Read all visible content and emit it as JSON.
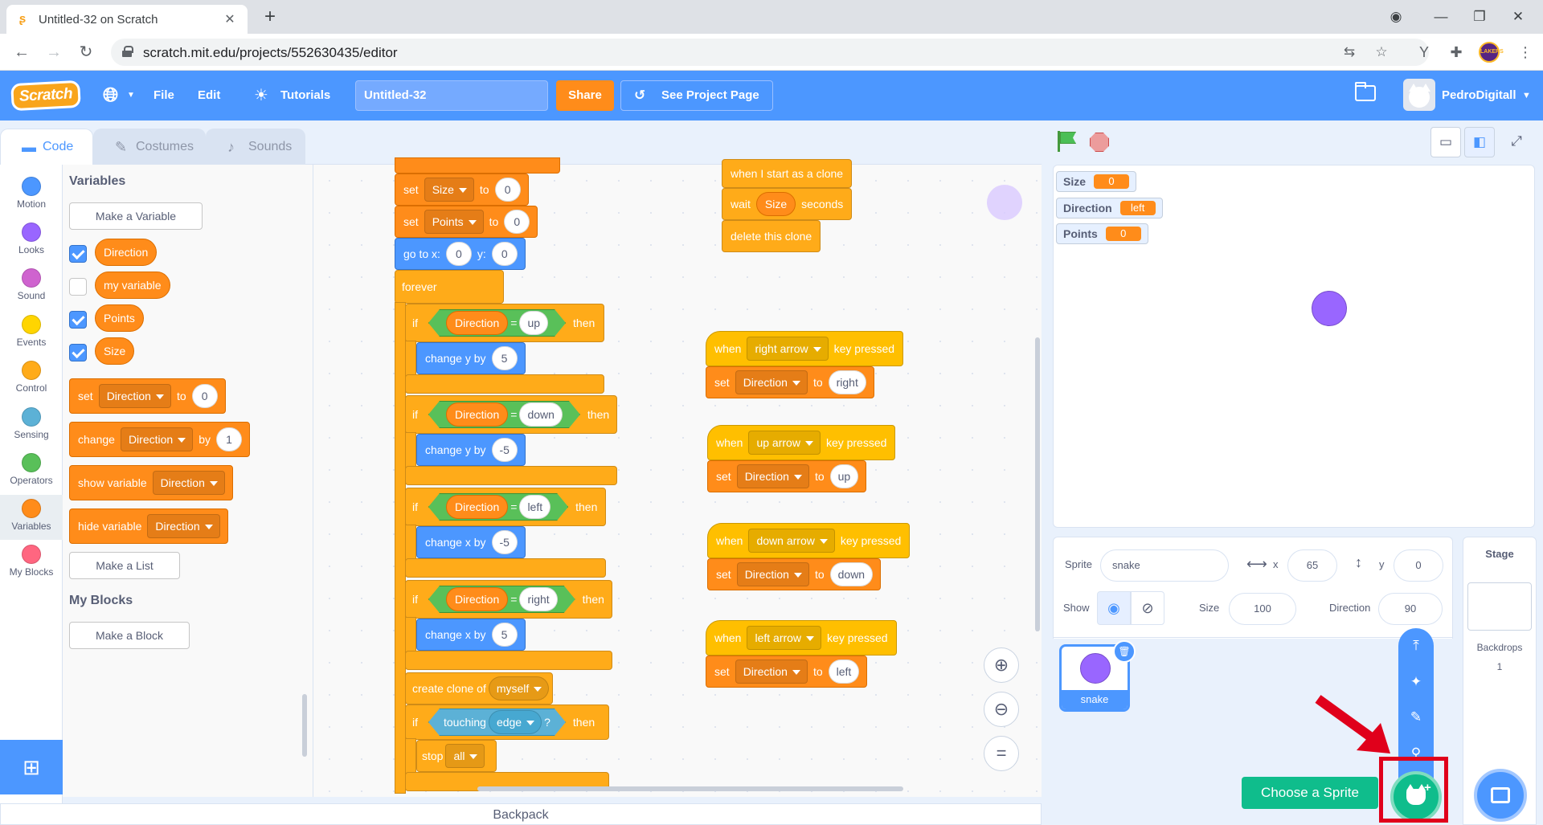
{
  "browser": {
    "tab_title": "Untitled-32 on Scratch",
    "url": "scratch.mit.edu/projects/552630435/editor",
    "profile_badge": "LAKERS"
  },
  "menubar": {
    "logo": "Scratch",
    "file": "File",
    "edit": "Edit",
    "tutorials": "Tutorials",
    "project_title": "Untitled-32",
    "share": "Share",
    "see_project_page": "See Project Page",
    "username": "PedroDigitall"
  },
  "tabs": {
    "code": "Code",
    "costumes": "Costumes",
    "sounds": "Sounds"
  },
  "categories": [
    {
      "label": "Motion",
      "color": "#4c97ff"
    },
    {
      "label": "Looks",
      "color": "#9966ff"
    },
    {
      "label": "Sound",
      "color": "#cf63cf"
    },
    {
      "label": "Events",
      "color": "#ffd500"
    },
    {
      "label": "Control",
      "color": "#ffab19"
    },
    {
      "label": "Sensing",
      "color": "#5cb1d6"
    },
    {
      "label": "Operators",
      "color": "#59c059"
    },
    {
      "label": "Variables",
      "color": "#ff8c1a"
    },
    {
      "label": "My Blocks",
      "color": "#ff6680"
    }
  ],
  "palette": {
    "variables_heading": "Variables",
    "make_variable": "Make a Variable",
    "variables": [
      {
        "name": "Direction",
        "checked": true
      },
      {
        "name": "my variable",
        "checked": false
      },
      {
        "name": "Points",
        "checked": true
      },
      {
        "name": "Size",
        "checked": true
      }
    ],
    "set_block": {
      "word": "set",
      "var": "Direction",
      "to": "to",
      "value": "0"
    },
    "change_block": {
      "word": "change",
      "var": "Direction",
      "by": "by",
      "value": "1"
    },
    "show_block": {
      "word": "show variable",
      "var": "Direction"
    },
    "hide_block": {
      "word": "hide variable",
      "var": "Direction"
    },
    "make_list": "Make a List",
    "myblocks_heading": "My Blocks",
    "make_block": "Make a Block"
  },
  "script_main": {
    "set": "set",
    "to": "to",
    "set_size_var": "Size",
    "set_size_val": "0",
    "set_points_var": "Points",
    "set_points_val": "0",
    "goto": "go to x:",
    "goto_x": "0",
    "goto_y_label": "y:",
    "goto_y": "0",
    "forever": "forever",
    "if": "if",
    "then": "then",
    "eq": "=",
    "cond_var": "Direction",
    "up": "up",
    "down": "down",
    "left": "left",
    "right": "right",
    "change_y": "change y by",
    "change_x": "change x by",
    "v_plus5": "5",
    "v_minus5": "-5",
    "create_clone": "create clone of",
    "myself": "myself",
    "touching": "touching",
    "edge": "edge",
    "q": "?",
    "stop": "stop",
    "all": "all"
  },
  "script_clone": {
    "hat": "when I start as a clone",
    "wait": "wait",
    "wait_var": "Size",
    "seconds": "seconds",
    "delete": "delete this clone"
  },
  "key_scripts": [
    {
      "when": "when",
      "key": "right arrow",
      "pressed": "key pressed",
      "set": "set",
      "var": "Direction",
      "to": "to",
      "value": "right"
    },
    {
      "when": "when",
      "key": "up arrow",
      "pressed": "key pressed",
      "set": "set",
      "var": "Direction",
      "to": "to",
      "value": "up"
    },
    {
      "when": "when",
      "key": "down arrow",
      "pressed": "key pressed",
      "set": "set",
      "var": "Direction",
      "to": "to",
      "value": "down"
    },
    {
      "when": "when",
      "key": "left arrow",
      "pressed": "key pressed",
      "set": "set",
      "var": "Direction",
      "to": "to",
      "value": "left"
    }
  ],
  "backpack": "Backpack",
  "monitors": [
    {
      "label": "Size",
      "value": "0"
    },
    {
      "label": "Direction",
      "value": "left"
    },
    {
      "label": "Points",
      "value": "0"
    }
  ],
  "sprite_info": {
    "sprite_label": "Sprite",
    "sprite_name": "snake",
    "x_label": "x",
    "x": "65",
    "y_label": "y",
    "y": "0",
    "show_label": "Show",
    "size_label": "Size",
    "size": "100",
    "direction_label": "Direction",
    "direction": "90"
  },
  "sprites": [
    {
      "name": "snake"
    }
  ],
  "choose_sprite": "Choose a Sprite",
  "stage_panel": {
    "title": "Stage",
    "backdrops_label": "Backdrops",
    "backdrops_count": "1"
  },
  "colors": {
    "accent": "#4c97ff",
    "variables": "#ff8c1a",
    "highlight": "#e0001b"
  }
}
